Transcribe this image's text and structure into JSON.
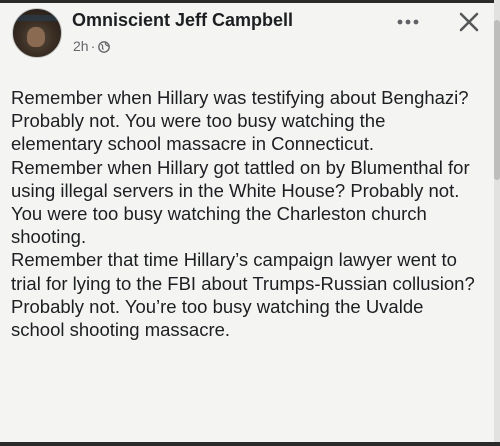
{
  "post": {
    "author": "Omniscient Jeff Campbell",
    "timestamp": "2h",
    "separator": "·",
    "privacy_icon": "globe-icon",
    "more_icon": "more-horizontal-icon",
    "close_icon": "close-icon",
    "paragraphs": [
      "Remember when Hillary was testifying about Benghazi? Probably not. You were too busy watching the elementary school massacre in Connecticut.",
      "Remember when Hillary got tattled on by Blumenthal for using illegal servers in the White House? Probably not. You were too busy watching the Charleston church shooting.",
      "Remember that time Hillary’s campaign lawyer went to trial for lying to the FBI about Trumps-Russian collusion? Probably not. You’re too busy watching the Uvalde school shooting massacre."
    ]
  },
  "colors": {
    "background": "#f4f4f2",
    "text": "#1c1e21",
    "secondary_text": "#65676b"
  }
}
